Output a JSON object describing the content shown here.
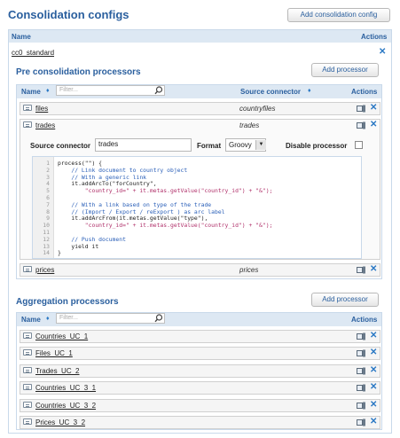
{
  "page": {
    "title": "Consolidation configs",
    "add_button": "Add consolidation config"
  },
  "main_table": {
    "col_name": "Name",
    "col_actions": "Actions",
    "config_name": "cc0_standard",
    "close_glyph": "✕"
  },
  "pre": {
    "title": "Pre consolidation processors",
    "add_button": "Add processor",
    "col_name": "Name",
    "col_source": "Source connector",
    "col_actions": "Actions",
    "filter_placeholder": "Filter...",
    "rows": [
      {
        "name": "files",
        "source": "countryfiles"
      },
      {
        "name": "trades",
        "source": "trades"
      },
      {
        "name": "prices",
        "source": "prices"
      }
    ],
    "editor": {
      "source_label": "Source connector",
      "source_value": "trades",
      "format_label": "Format",
      "format_value": "Groovy",
      "disable_label": "Disable processor",
      "line_numbers": [
        "1",
        "2",
        "3",
        "4",
        "5",
        "6",
        "7",
        "8",
        "9",
        "10",
        "11",
        "12",
        "13",
        "14"
      ],
      "lines": [
        "process(\"\") {",
        "    // Link document to country object",
        "    // With a generic link",
        "    it.addArcTo(\"forCountry\",",
        "        \"country_id=\" + it.metas.getValue(\"country_id\") + \"&\");",
        "",
        "    // With a link based on type of the trade",
        "    // (Import / Export / reExport ) as arc label",
        "    it.addArcFrom(it.metas.getValue(\"type\"),",
        "        \"country_id=\" + it.metas.getValue(\"country_id\") + \"&\");",
        "",
        "    // Push document",
        "    yield it",
        "}"
      ]
    }
  },
  "agg": {
    "title": "Aggregation processors",
    "add_button": "Add processor",
    "col_name": "Name",
    "col_actions": "Actions",
    "filter_placeholder": "Filter...",
    "rows": [
      {
        "name": "Countries_UC_1"
      },
      {
        "name": "Files_UC_1"
      },
      {
        "name": "Trades_UC_2"
      },
      {
        "name": "Countries_UC_3_1"
      },
      {
        "name": "Countries_UC_3_2"
      },
      {
        "name": "Prices_UC_3_2"
      }
    ]
  },
  "colors": {
    "accent": "#2a5f9e",
    "header_bg": "#dde8f3",
    "close": "#2a78c4"
  },
  "icons": {
    "row": "document-icon",
    "edit": "edit-icon",
    "close": "close-icon",
    "search": "search-icon",
    "sort": "sort-icon"
  }
}
